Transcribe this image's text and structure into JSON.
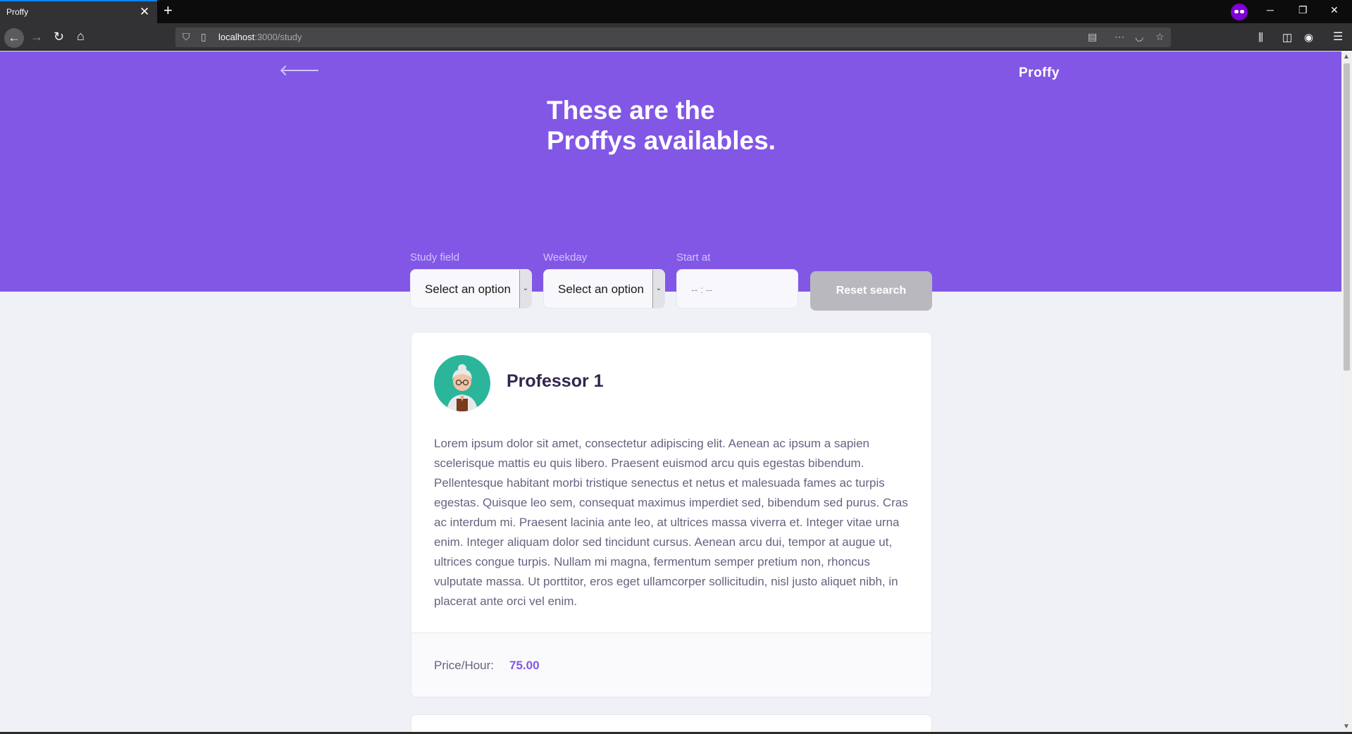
{
  "browser": {
    "tab_title": "Proffy",
    "tab_close": "✕",
    "new_tab": "+",
    "url_host": "localhost",
    "url_path": ":3000/study",
    "window_controls": [
      "─",
      "❐",
      "✕"
    ]
  },
  "header": {
    "logo": "Proffy",
    "title_line1": "These are the",
    "title_line2": "Proffys availables."
  },
  "filters": {
    "study_field": {
      "label": "Study field",
      "value": "Select an option"
    },
    "weekday": {
      "label": "Weekday",
      "value": "Select an option"
    },
    "start_at": {
      "label": "Start at",
      "placeholder": "-- : --"
    },
    "reset_label": "Reset search"
  },
  "teachers": [
    {
      "name": "Professor 1",
      "bio": "Lorem ipsum dolor sit amet, consectetur adipiscing elit. Aenean ac ipsum a sapien scelerisque mattis eu quis libero. Praesent euismod arcu quis egestas bibendum. Pellentesque habitant morbi tristique senectus et netus et malesuada fames ac turpis egestas. Quisque leo sem, consequat maximus imperdiet sed, bibendum sed purus. Cras ac interdum mi. Praesent lacinia ante leo, at ultrices massa viverra et. Integer vitae urna enim. Integer aliquam dolor sed tincidunt cursus. Aenean arcu dui, tempor at augue ut, ultrices congue turpis. Nullam mi magna, fermentum semper pretium non, rhoncus vulputate massa. Ut porttitor, eros eget ullamcorper sollicitudin, nisl justo aliquet nibh, in placerat ante orci vel enim.",
      "price_label": "Price/Hour:",
      "price": "75.00"
    }
  ],
  "colors": {
    "primary": "#8257E5",
    "background": "#F0F0F7",
    "title_dark": "#32264D",
    "text_base": "#6A6180"
  }
}
